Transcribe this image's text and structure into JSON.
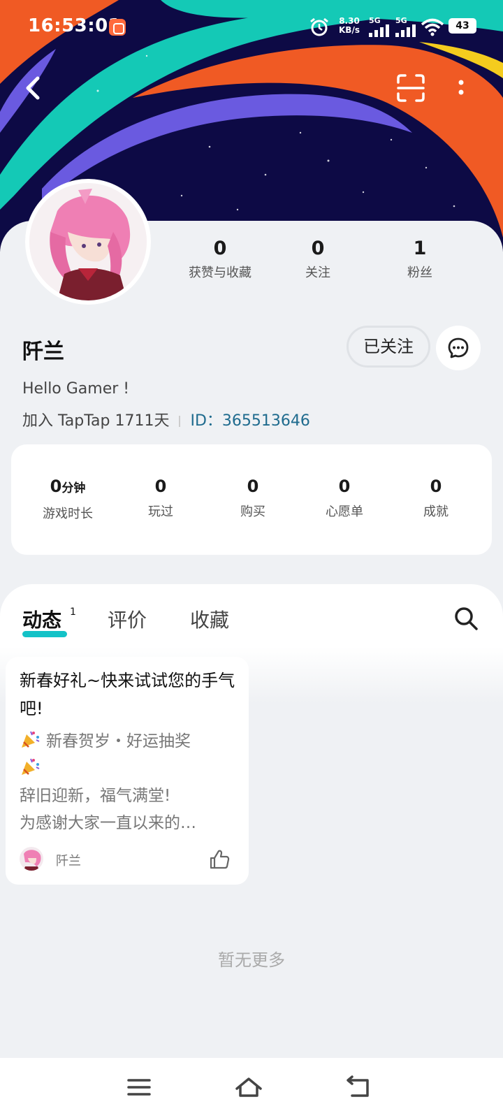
{
  "status_bar": {
    "time": "16:53:01",
    "speed_top": "8.30",
    "speed_unit": "KB/s",
    "signal1": "5G",
    "signal2": "5G",
    "battery": "43"
  },
  "profile": {
    "stats": [
      {
        "value": "0",
        "label": "获赞与收藏"
      },
      {
        "value": "0",
        "label": "关注"
      },
      {
        "value": "1",
        "label": "粉丝"
      }
    ],
    "username": "阡兰",
    "follow_label": "已关注",
    "bio": "Hello Gamer !",
    "join_text": "加入 TapTap 1711天",
    "id_text": "ID：365513646"
  },
  "game_stats": [
    {
      "value": "0",
      "unit": "分钟",
      "label": "游戏时长"
    },
    {
      "value": "0",
      "unit": "",
      "label": "玩过"
    },
    {
      "value": "0",
      "unit": "",
      "label": "购买"
    },
    {
      "value": "0",
      "unit": "",
      "label": "心愿单"
    },
    {
      "value": "0",
      "unit": "",
      "label": "成就"
    }
  ],
  "tabs": {
    "active": "动态",
    "active_count": "1",
    "reviews": "评价",
    "favorites": "收藏"
  },
  "post": {
    "title": "新春好礼~快来试试您的手气吧!",
    "line1": "新春贺岁・好运抽奖",
    "line2": "辞旧迎新，福气满堂!",
    "line3": "为感谢大家一直以来的…",
    "author": "阡兰"
  },
  "no_more": "暂无更多",
  "colors": {
    "accent": "#14c2c7",
    "id_link": "#1f6b8e"
  }
}
